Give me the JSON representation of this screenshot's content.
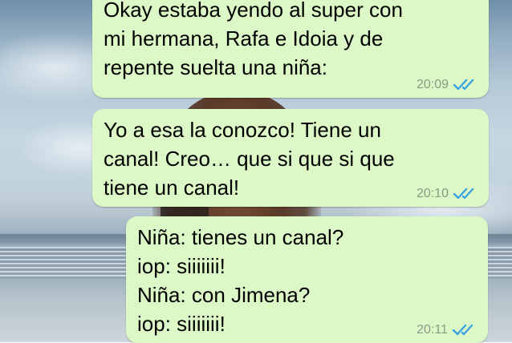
{
  "chat": {
    "background": {
      "colors": {
        "sky": "#b3c8d6",
        "sea": "#8196a5",
        "bubble": "#dcf8c6",
        "time_text": "#8a9a86",
        "read_ticks": "#3aa3e3"
      }
    },
    "messages": [
      {
        "lines": [
          "Okay estaba yendo al super con",
          "mi hermana, Rafa e Idoia y de",
          "repente suelta una niña:"
        ],
        "time": "20:09",
        "status_icon": "double-check-read-icon"
      },
      {
        "lines": [
          "Yo a esa la conozco! Tiene un",
          "canal! Creo… que si que si que",
          "tiene un canal!"
        ],
        "time": "20:10",
        "status_icon": "double-check-read-icon"
      },
      {
        "lines": [
          "Niña: tienes un canal?",
          "iop: siiiiiii!",
          "Niña: con Jimena?",
          "iop: siiiiiii!"
        ],
        "time": "20:11",
        "status_icon": "double-check-read-icon"
      }
    ]
  }
}
